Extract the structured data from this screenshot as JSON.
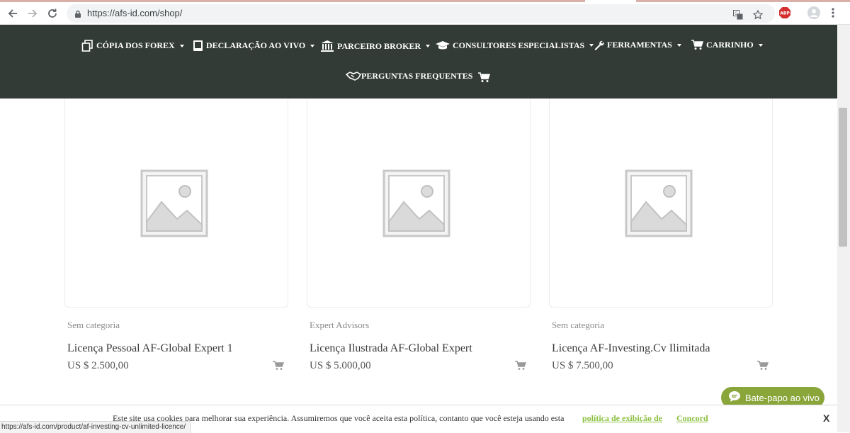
{
  "browser": {
    "url": "https://afs-id.com/shop/",
    "status_url": "https://afs-id.com/product/af-investing-cv-unlimited-licence/",
    "icons": [
      "back-icon",
      "forward-icon",
      "reload-icon",
      "lock-icon",
      "translate-icon",
      "star-icon",
      "adblock-icon",
      "profile-icon",
      "menu-icon"
    ],
    "adblock_label": "ABP"
  },
  "nav": {
    "items": [
      {
        "label": "CÓPIA DOS FOREX",
        "icon": "copy-icon",
        "dropdown": true
      },
      {
        "label": "DECLARAÇÃO AO VIVO",
        "icon": "book-icon",
        "dropdown": true
      },
      {
        "label": "PARCEIRO BROKER",
        "icon": "bank-icon",
        "dropdown": true
      },
      {
        "label": "CONSULTORES ESPECIALISTAS",
        "icon": "graduation-cap-icon",
        "dropdown": true
      },
      {
        "label": "FERRAMENTAS",
        "icon": "wrench-icon",
        "dropdown": true
      },
      {
        "label": "CARRINHO",
        "icon": "cart-icon",
        "dropdown": true
      },
      {
        "label": "PERGUNTAS FREQUENTES",
        "icon": "handshake-icon",
        "dropdown": false
      }
    ]
  },
  "products": [
    {
      "category": "Sem categoria",
      "title": "Licença Pessoal AF-Global Expert 1",
      "price": "US $ 2.500,00"
    },
    {
      "category": "Expert Advisors",
      "title": "Licença Ilustrada AF-Global Expert",
      "price": "US $ 5.000,00"
    },
    {
      "category": "Sem categoria",
      "title": "Licença AF-Investing.Cv Ilimitada",
      "price": "US $ 7.500,00"
    }
  ],
  "chat": {
    "label": "Bate-papo ao vivo"
  },
  "cookie": {
    "text": "Este site usa cookies para melhorar sua experiência. Assumiremos que você aceita esta política, contanto que você esteja usando esta",
    "policy_link": "política de exibição de",
    "agree": "Concord",
    "close": "X"
  },
  "colors": {
    "nav_bg": "#323b36",
    "chat_bg": "#8aa63a",
    "cookie_link": "#8bbf3f"
  }
}
